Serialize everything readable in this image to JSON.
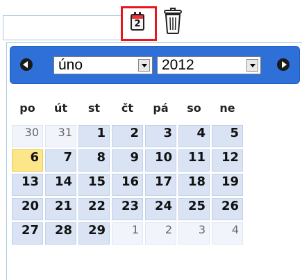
{
  "input": {
    "value": "",
    "placeholder": ""
  },
  "toolbar": {
    "calendar_icon_number": "2"
  },
  "calendar": {
    "month": "úno",
    "year": "2012",
    "weekdays": [
      "po",
      "út",
      "st",
      "čt",
      "pá",
      "so",
      "ne"
    ],
    "weeks": [
      [
        {
          "d": "30",
          "o": true
        },
        {
          "d": "31",
          "o": true
        },
        {
          "d": "1"
        },
        {
          "d": "2"
        },
        {
          "d": "3"
        },
        {
          "d": "4"
        },
        {
          "d": "5"
        }
      ],
      [
        {
          "d": "6",
          "t": true
        },
        {
          "d": "7"
        },
        {
          "d": "8"
        },
        {
          "d": "9"
        },
        {
          "d": "10"
        },
        {
          "d": "11"
        },
        {
          "d": "12"
        }
      ],
      [
        {
          "d": "13"
        },
        {
          "d": "14"
        },
        {
          "d": "15"
        },
        {
          "d": "16"
        },
        {
          "d": "17"
        },
        {
          "d": "18"
        },
        {
          "d": "19"
        }
      ],
      [
        {
          "d": "20"
        },
        {
          "d": "21"
        },
        {
          "d": "22"
        },
        {
          "d": "23"
        },
        {
          "d": "24"
        },
        {
          "d": "25"
        },
        {
          "d": "26"
        }
      ],
      [
        {
          "d": "27"
        },
        {
          "d": "28"
        },
        {
          "d": "29"
        },
        {
          "d": "1",
          "o": true
        },
        {
          "d": "2",
          "o": true
        },
        {
          "d": "3",
          "o": true
        },
        {
          "d": "4",
          "o": true
        }
      ]
    ]
  },
  "colors": {
    "header": "#2e6fd8",
    "highlight": "#fce68a",
    "day_cell": "#d9e3f3",
    "outline": "#e8151b"
  },
  "icons": {
    "calendar": "calendar-icon",
    "trash": "trash-icon",
    "prev": "prev-arrow-icon",
    "next": "next-arrow-icon"
  }
}
